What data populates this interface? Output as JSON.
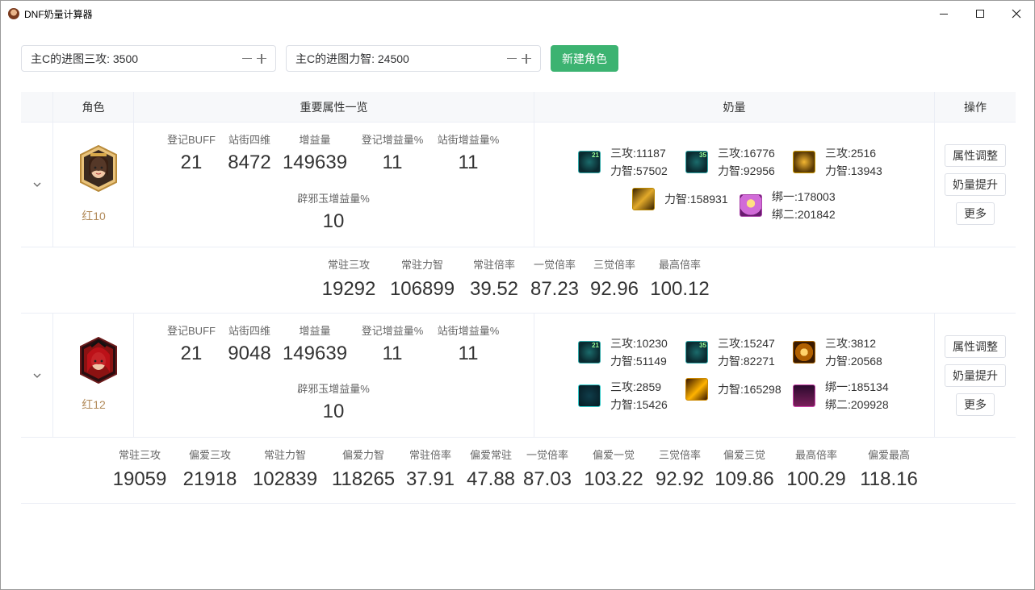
{
  "window": {
    "title": "DNF奶量计算器"
  },
  "controls": {
    "main_c_sangong": "主C的进图三攻: 3500",
    "main_c_lizhi": "主C的进图力智: 24500",
    "new_role_button": "新建角色"
  },
  "table": {
    "headers": [
      "角色",
      "重要属性一览",
      "奶量",
      "操作"
    ]
  },
  "rows": [
    {
      "role_label": "红10",
      "attrs": [
        {
          "k": "登记BUFF",
          "v": "21"
        },
        {
          "k": "站街四维",
          "v": "8472"
        },
        {
          "k": "增益量",
          "v": "149639"
        },
        {
          "k": "登记增益量%",
          "v": "11"
        },
        {
          "k": "站街增益量%",
          "v": "11"
        },
        {
          "k": "辟邪玉增益量%",
          "v": "10"
        }
      ],
      "milk": [
        {
          "icon": "teal-sword-21-icon",
          "l1": "三攻:11187",
          "l2": "力智:57502",
          "badge": "21"
        },
        {
          "icon": "teal-sword-35-icon",
          "l1": "三攻:16776",
          "l2": "力智:92956",
          "badge": "35"
        },
        {
          "icon": "gold-rune-icon",
          "l1": "三攻:2516",
          "l2": "力智:13943"
        },
        {
          "icon": "amber-seal-icon",
          "l1": "力智:158931"
        },
        {
          "icon": "pink-awakening-icon",
          "l1": "绑一:178003",
          "l2": "绑二:201842"
        }
      ],
      "ops": [
        "属性调整",
        "奶量提升",
        "更多"
      ],
      "summary": [
        {
          "k": "常驻三攻",
          "v": "19292"
        },
        {
          "k": "常驻力智",
          "v": "106899"
        },
        {
          "k": "常驻倍率",
          "v": "39.52"
        },
        {
          "k": "一觉倍率",
          "v": "87.23"
        },
        {
          "k": "三觉倍率",
          "v": "92.96"
        },
        {
          "k": "最高倍率",
          "v": "100.12"
        }
      ]
    },
    {
      "role_label": "红12",
      "attrs": [
        {
          "k": "登记BUFF",
          "v": "21"
        },
        {
          "k": "站街四维",
          "v": "9048"
        },
        {
          "k": "增益量",
          "v": "149639"
        },
        {
          "k": "登记增益量%",
          "v": "11"
        },
        {
          "k": "站街增益量%",
          "v": "11"
        },
        {
          "k": "辟邪玉增益量%",
          "v": "10"
        }
      ],
      "milk": [
        {
          "icon": "teal-orb-21-icon",
          "l1": "三攻:10230",
          "l2": "力智:51149",
          "badge": "21"
        },
        {
          "icon": "teal-orb-35-icon",
          "l1": "三攻:15247",
          "l2": "力智:82271",
          "badge": "35"
        },
        {
          "icon": "gold-key-icon",
          "l1": "三攻:3812",
          "l2": "力智:20568"
        },
        {
          "icon": "heart-shield-icon",
          "l1": "三攻:2859",
          "l2": "力智:15426"
        },
        {
          "icon": "golden-wing-icon",
          "l1": "力智:165298"
        },
        {
          "icon": "star-awakening-icon",
          "l1": "绑一:185134",
          "l2": "绑二:209928"
        }
      ],
      "ops": [
        "属性调整",
        "奶量提升",
        "更多"
      ],
      "summary": [
        {
          "k": "常驻三攻",
          "v": "19059"
        },
        {
          "k": "偏爱三攻",
          "v": "21918"
        },
        {
          "k": "常驻力智",
          "v": "102839"
        },
        {
          "k": "偏爱力智",
          "v": "118265"
        },
        {
          "k": "常驻倍率",
          "v": "37.91"
        },
        {
          "k": "偏爱常驻",
          "v": "47.88"
        },
        {
          "k": "一觉倍率",
          "v": "87.03"
        },
        {
          "k": "偏爱一觉",
          "v": "103.22"
        },
        {
          "k": "三觉倍率",
          "v": "92.92"
        },
        {
          "k": "偏爱三觉",
          "v": "109.86"
        },
        {
          "k": "最高倍率",
          "v": "100.29"
        },
        {
          "k": "偏爱最高",
          "v": "118.16"
        }
      ]
    }
  ]
}
